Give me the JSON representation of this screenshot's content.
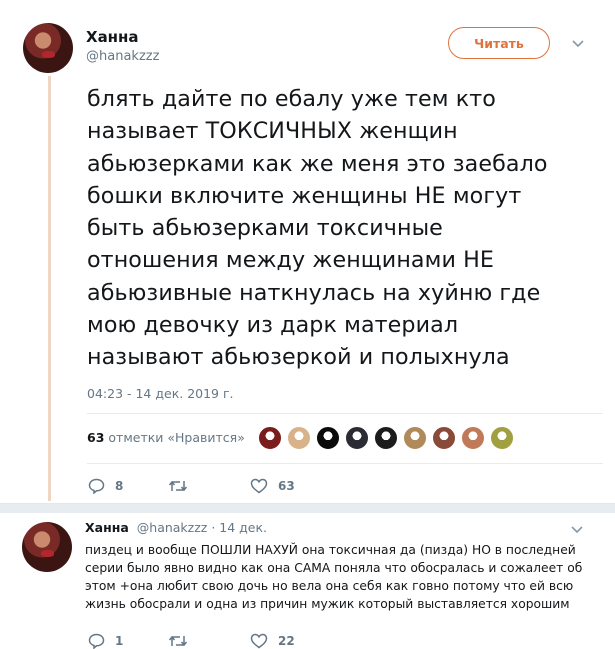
{
  "tweet": {
    "author_name": "Ханна",
    "author_handle": "@hanakzzz",
    "follow_label": "Читать",
    "text": "блять дайте по ебалу уже тем кто\nназывает ТОКСИЧНЫХ женщин\nабьюзерками как же меня это заебало\nбошки включите женщины НЕ могут\nбыть абьюзерками токсичные\nотношения между женщинами НЕ\nабьюзивные наткнулась на хуйню где\nмою девочку из дарк материал\nназывают абьюзеркой и полыхнула",
    "timestamp": "04:23 - 14 дек. 2019 г.",
    "likes_count": "63",
    "likes_label": "отметки «Нравится»",
    "liker_colors": [
      "#7a1d1d",
      "#d8b38a",
      "#0b0b0b",
      "#2b2b33",
      "#1c1c1c",
      "#b08a5a",
      "#8a4a3a",
      "#c07a5a",
      "#a0a040"
    ],
    "replies": "8",
    "retweets": "",
    "likes": "63",
    "accent_color": "#e0733c"
  },
  "reply": {
    "author_name": "Ханна",
    "author_handle": "@hanakzzz",
    "date": "· 14 дек.",
    "text": "пиздец и вообще ПОШЛИ НАХУЙ она токсичная да (пизда) НО в последней\nсерии было явно видно как она САМА поняла что обосралась и сожалеет об\nэтом +она любит свою дочь но вела она себя как говно потому что ей всю\nжизнь обосрали и одна из причин мужик который выставляется хорошим",
    "replies": "1",
    "retweets": "",
    "likes": "22"
  }
}
